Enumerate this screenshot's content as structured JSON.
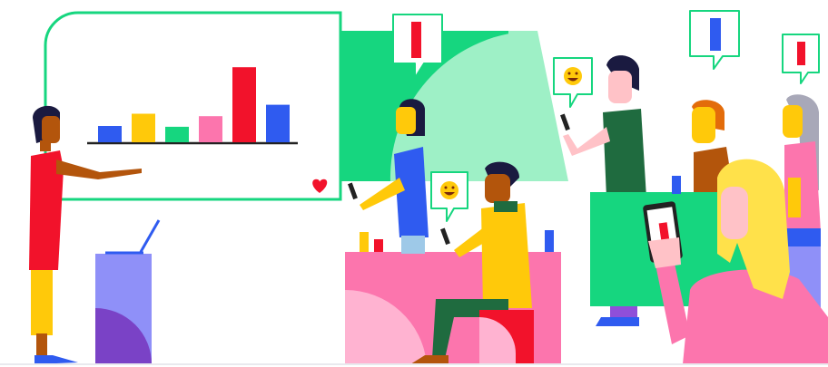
{
  "scene": {
    "colors": {
      "background": "#ffffff",
      "mint": "#9ef0c6",
      "green": "#16d67f",
      "red": "#f2122b",
      "blue": "#2f5bf0",
      "yellow": "#ffc90a",
      "pink": "#fc75ad",
      "lavender": "#8f90f8",
      "dark_green": "#1f6b3f",
      "skin_brown": "#b3550c",
      "skin_pink": "#ffc2c7",
      "dark_hair": "#1a1a40"
    }
  },
  "chart_data": {
    "type": "bar",
    "categories": [
      "",
      "",
      "",
      "",
      "",
      ""
    ],
    "values": [
      2,
      3.5,
      1.9,
      3.2,
      9.2,
      4.6
    ],
    "colors": [
      "#2f5bf0",
      "#ffc90a",
      "#16d67f",
      "#fc75ad",
      "#f2122b",
      "#2f5bf0"
    ],
    "title": "",
    "xlabel": "",
    "ylabel": "",
    "ylim": [
      0,
      10
    ],
    "grid": false,
    "legend": "none"
  },
  "speech_bubbles": [
    {
      "icon": "red-bar-icon"
    },
    {
      "icon": "smiley-icon"
    },
    {
      "icon": "smiley-icon"
    },
    {
      "icon": "blue-bar-icon"
    },
    {
      "icon": "red-bar-icon"
    }
  ],
  "icons": {
    "heart": "heart-icon"
  }
}
